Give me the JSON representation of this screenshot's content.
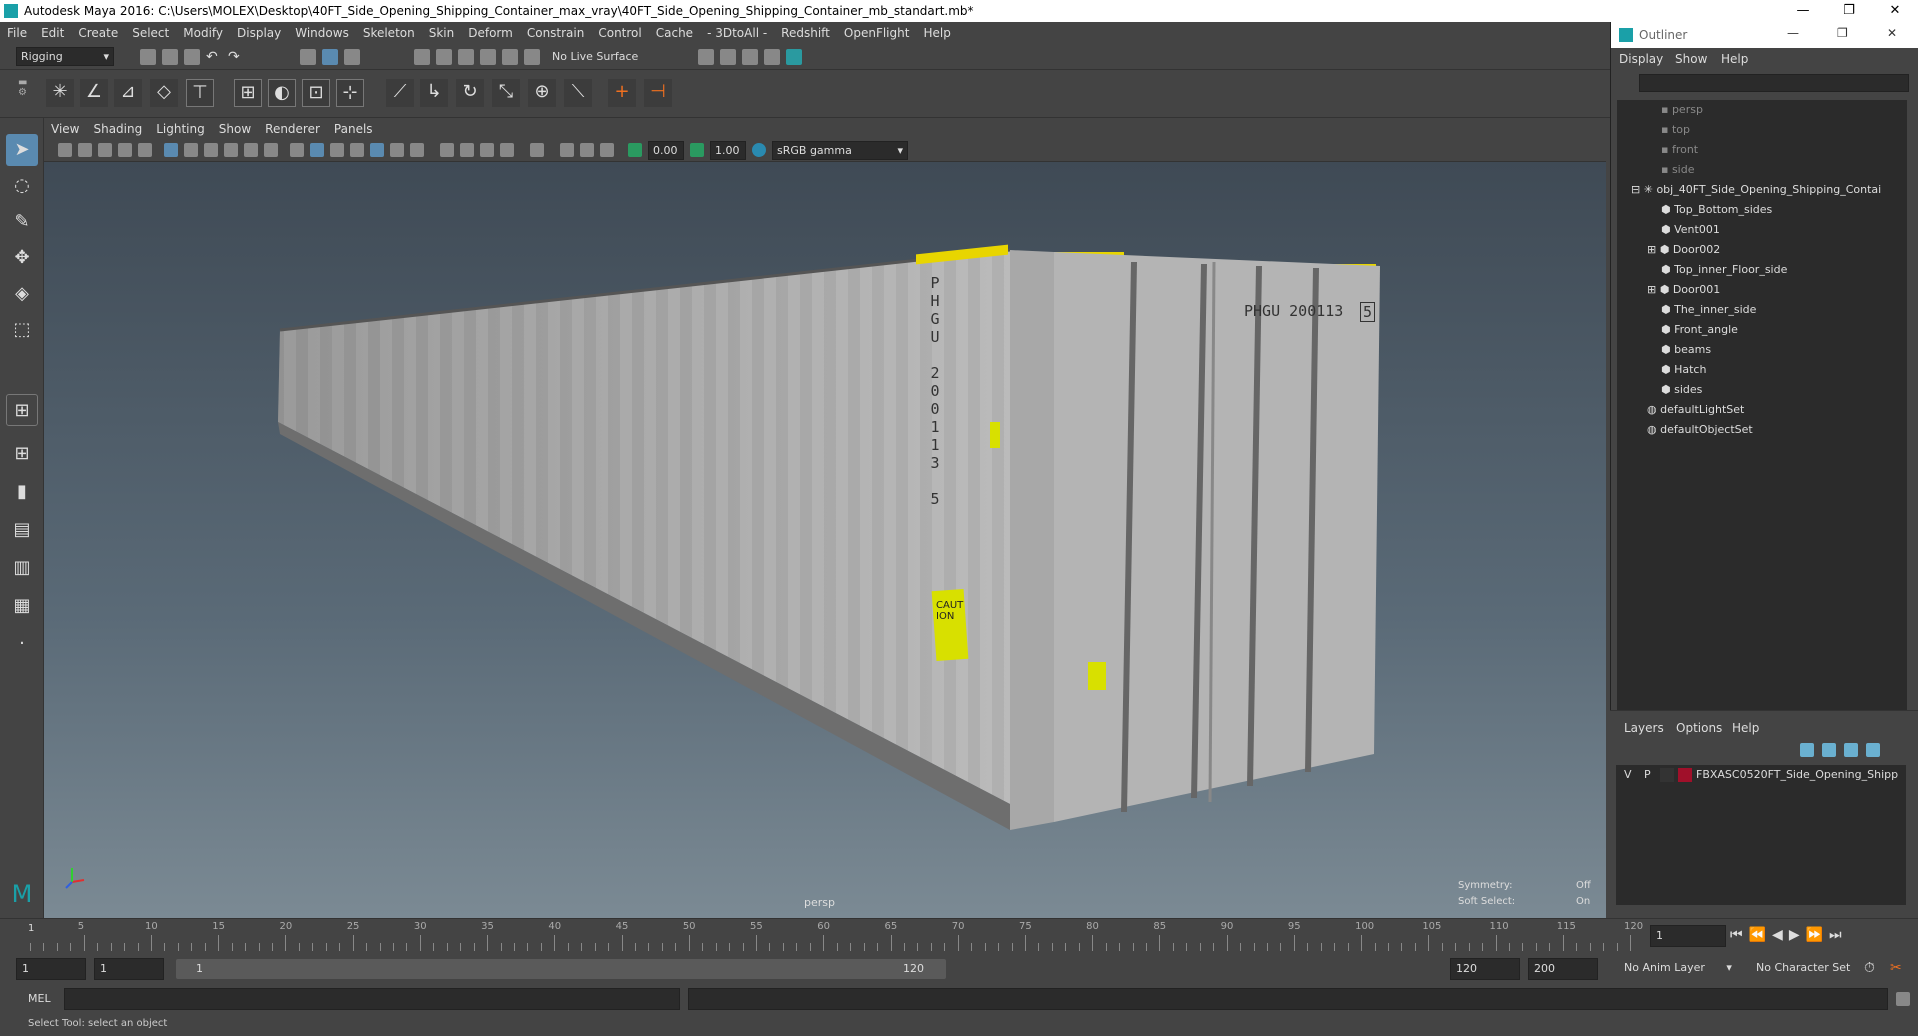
{
  "window": {
    "title": "Autodesk Maya 2016: C:\\Users\\MOLEX\\Desktop\\40FT_Side_Opening_Shipping_Container_max_vray\\40FT_Side_Opening_Shipping_Container_mb_standart.mb*",
    "controls": [
      "—",
      "❐",
      "✕"
    ]
  },
  "menubar": [
    "File",
    "Edit",
    "Create",
    "Select",
    "Modify",
    "Display",
    "Windows",
    "Skeleton",
    "Skin",
    "Deform",
    "Constrain",
    "Control",
    "Cache",
    "- 3DtoAll -",
    "Redshift",
    "OpenFlight",
    "Help"
  ],
  "status": {
    "mode": "Rigging",
    "live_surface": "No Live Surface"
  },
  "panel_menu": [
    "View",
    "Shading",
    "Lighting",
    "Show",
    "Renderer",
    "Panels"
  ],
  "panel_bar": {
    "value1": "0.00",
    "value2": "1.00",
    "color_space": "sRGB gamma"
  },
  "viewport": {
    "camera": "persp",
    "symmetry_label": "Symmetry:",
    "symmetry_value": "Off",
    "soft_select_label": "Soft Select:",
    "soft_select_value": "On",
    "container_id_side": "PHGU 200113 5",
    "container_id_door": "PHGU 200113",
    "container_check_digit": "5",
    "caution_label": "CAUTION"
  },
  "outliner": {
    "title": "Outliner",
    "menu": [
      "Display",
      "Show",
      "Help"
    ],
    "items": [
      {
        "label": "persp",
        "dim": true
      },
      {
        "label": "top",
        "dim": true
      },
      {
        "label": "front",
        "dim": true
      },
      {
        "label": "side",
        "dim": true
      },
      {
        "label": "obj_40FT_Side_Opening_Shipping_Contai",
        "dim": false
      },
      {
        "label": "Top_Bottom_sides",
        "dim": false
      },
      {
        "label": "Vent001",
        "dim": false
      },
      {
        "label": "Door002",
        "dim": false
      },
      {
        "label": "Top_inner_Floor_side",
        "dim": false
      },
      {
        "label": "Door001",
        "dim": false
      },
      {
        "label": "The_inner_side",
        "dim": false
      },
      {
        "label": "Front_angle",
        "dim": false
      },
      {
        "label": "beams",
        "dim": false
      },
      {
        "label": "Hatch",
        "dim": false
      },
      {
        "label": "sides",
        "dim": false
      },
      {
        "label": "defaultLightSet",
        "dim": false
      },
      {
        "label": "defaultObjectSet",
        "dim": false
      }
    ]
  },
  "layers": {
    "menu": [
      "Layers",
      "Options",
      "Help"
    ],
    "row": {
      "v": "V",
      "p": "P",
      "name": "FBXASC0520FT_Side_Opening_Shipp",
      "color": "#a0102a"
    }
  },
  "timeline": {
    "ticks": [
      "5",
      "10",
      "15",
      "20",
      "25",
      "30",
      "35",
      "40",
      "45",
      "50",
      "55",
      "60",
      "65",
      "70",
      "75",
      "80",
      "85",
      "90",
      "95",
      "100",
      "105",
      "110",
      "115",
      "120"
    ],
    "start_marker": "1",
    "current_frame": "1"
  },
  "range": {
    "start": "1",
    "start2": "1",
    "slider_start": "1",
    "slider_end": "120",
    "end": "120",
    "end2": "200",
    "anim_layer": "No Anim Layer",
    "character_set": "No Character Set"
  },
  "cmdline": {
    "label": "MEL"
  },
  "help_line": "Select Tool: select an object",
  "colors": {
    "accent": "#1aa0a8",
    "hazard": "#e8d500",
    "caution": "#d8e000"
  }
}
